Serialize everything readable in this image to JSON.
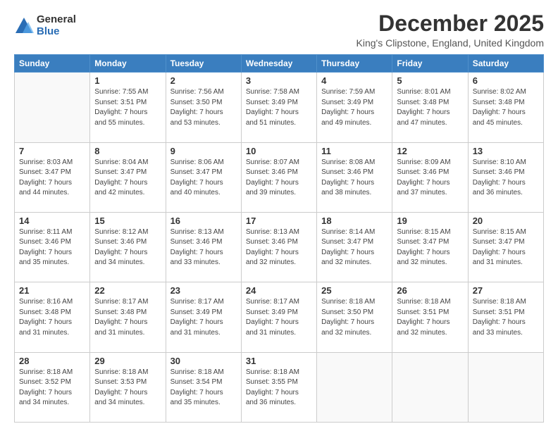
{
  "logo": {
    "general": "General",
    "blue": "Blue"
  },
  "title": "December 2025",
  "location": "King's Clipstone, England, United Kingdom",
  "days_of_week": [
    "Sunday",
    "Monday",
    "Tuesday",
    "Wednesday",
    "Thursday",
    "Friday",
    "Saturday"
  ],
  "weeks": [
    [
      {
        "day": "",
        "info": ""
      },
      {
        "day": "1",
        "info": "Sunrise: 7:55 AM\nSunset: 3:51 PM\nDaylight: 7 hours\nand 55 minutes."
      },
      {
        "day": "2",
        "info": "Sunrise: 7:56 AM\nSunset: 3:50 PM\nDaylight: 7 hours\nand 53 minutes."
      },
      {
        "day": "3",
        "info": "Sunrise: 7:58 AM\nSunset: 3:49 PM\nDaylight: 7 hours\nand 51 minutes."
      },
      {
        "day": "4",
        "info": "Sunrise: 7:59 AM\nSunset: 3:49 PM\nDaylight: 7 hours\nand 49 minutes."
      },
      {
        "day": "5",
        "info": "Sunrise: 8:01 AM\nSunset: 3:48 PM\nDaylight: 7 hours\nand 47 minutes."
      },
      {
        "day": "6",
        "info": "Sunrise: 8:02 AM\nSunset: 3:48 PM\nDaylight: 7 hours\nand 45 minutes."
      }
    ],
    [
      {
        "day": "7",
        "info": "Sunrise: 8:03 AM\nSunset: 3:47 PM\nDaylight: 7 hours\nand 44 minutes."
      },
      {
        "day": "8",
        "info": "Sunrise: 8:04 AM\nSunset: 3:47 PM\nDaylight: 7 hours\nand 42 minutes."
      },
      {
        "day": "9",
        "info": "Sunrise: 8:06 AM\nSunset: 3:47 PM\nDaylight: 7 hours\nand 40 minutes."
      },
      {
        "day": "10",
        "info": "Sunrise: 8:07 AM\nSunset: 3:46 PM\nDaylight: 7 hours\nand 39 minutes."
      },
      {
        "day": "11",
        "info": "Sunrise: 8:08 AM\nSunset: 3:46 PM\nDaylight: 7 hours\nand 38 minutes."
      },
      {
        "day": "12",
        "info": "Sunrise: 8:09 AM\nSunset: 3:46 PM\nDaylight: 7 hours\nand 37 minutes."
      },
      {
        "day": "13",
        "info": "Sunrise: 8:10 AM\nSunset: 3:46 PM\nDaylight: 7 hours\nand 36 minutes."
      }
    ],
    [
      {
        "day": "14",
        "info": "Sunrise: 8:11 AM\nSunset: 3:46 PM\nDaylight: 7 hours\nand 35 minutes."
      },
      {
        "day": "15",
        "info": "Sunrise: 8:12 AM\nSunset: 3:46 PM\nDaylight: 7 hours\nand 34 minutes."
      },
      {
        "day": "16",
        "info": "Sunrise: 8:13 AM\nSunset: 3:46 PM\nDaylight: 7 hours\nand 33 minutes."
      },
      {
        "day": "17",
        "info": "Sunrise: 8:13 AM\nSunset: 3:46 PM\nDaylight: 7 hours\nand 32 minutes."
      },
      {
        "day": "18",
        "info": "Sunrise: 8:14 AM\nSunset: 3:47 PM\nDaylight: 7 hours\nand 32 minutes."
      },
      {
        "day": "19",
        "info": "Sunrise: 8:15 AM\nSunset: 3:47 PM\nDaylight: 7 hours\nand 32 minutes."
      },
      {
        "day": "20",
        "info": "Sunrise: 8:15 AM\nSunset: 3:47 PM\nDaylight: 7 hours\nand 31 minutes."
      }
    ],
    [
      {
        "day": "21",
        "info": "Sunrise: 8:16 AM\nSunset: 3:48 PM\nDaylight: 7 hours\nand 31 minutes."
      },
      {
        "day": "22",
        "info": "Sunrise: 8:17 AM\nSunset: 3:48 PM\nDaylight: 7 hours\nand 31 minutes."
      },
      {
        "day": "23",
        "info": "Sunrise: 8:17 AM\nSunset: 3:49 PM\nDaylight: 7 hours\nand 31 minutes."
      },
      {
        "day": "24",
        "info": "Sunrise: 8:17 AM\nSunset: 3:49 PM\nDaylight: 7 hours\nand 31 minutes."
      },
      {
        "day": "25",
        "info": "Sunrise: 8:18 AM\nSunset: 3:50 PM\nDaylight: 7 hours\nand 32 minutes."
      },
      {
        "day": "26",
        "info": "Sunrise: 8:18 AM\nSunset: 3:51 PM\nDaylight: 7 hours\nand 32 minutes."
      },
      {
        "day": "27",
        "info": "Sunrise: 8:18 AM\nSunset: 3:51 PM\nDaylight: 7 hours\nand 33 minutes."
      }
    ],
    [
      {
        "day": "28",
        "info": "Sunrise: 8:18 AM\nSunset: 3:52 PM\nDaylight: 7 hours\nand 34 minutes."
      },
      {
        "day": "29",
        "info": "Sunrise: 8:18 AM\nSunset: 3:53 PM\nDaylight: 7 hours\nand 34 minutes."
      },
      {
        "day": "30",
        "info": "Sunrise: 8:18 AM\nSunset: 3:54 PM\nDaylight: 7 hours\nand 35 minutes."
      },
      {
        "day": "31",
        "info": "Sunrise: 8:18 AM\nSunset: 3:55 PM\nDaylight: 7 hours\nand 36 minutes."
      },
      {
        "day": "",
        "info": ""
      },
      {
        "day": "",
        "info": ""
      },
      {
        "day": "",
        "info": ""
      }
    ]
  ]
}
